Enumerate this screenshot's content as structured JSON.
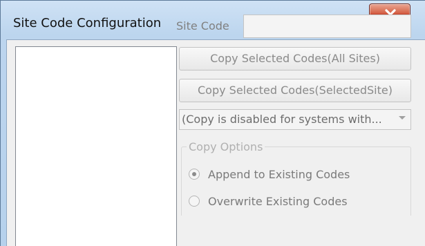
{
  "window": {
    "title": "Site Code Configuration"
  },
  "site_list": {
    "items": []
  },
  "site_code": {
    "label": "Site Code",
    "value": ""
  },
  "buttons": {
    "copy_all_sites": "Copy Selected Codes(All Sites)",
    "copy_selected_site": "Copy Selected Codes(SelectedSite)"
  },
  "combo": {
    "selected": "(Copy is disabled for systems with..."
  },
  "copy_options": {
    "legend": "Copy Options",
    "append_label": "Append to Existing Codes",
    "overwrite_label": "Overwrite Existing Codes",
    "selected": "append"
  },
  "icons": {
    "close": "close-icon",
    "dropdown": "chevron-down-icon"
  }
}
